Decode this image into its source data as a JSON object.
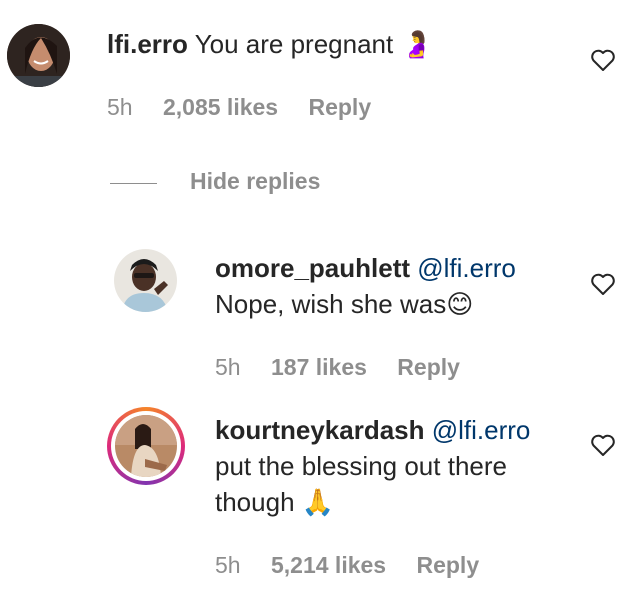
{
  "comments": [
    {
      "username": "lfi.erro",
      "mention": "",
      "text": "You are pregnant",
      "emoji": "🤰",
      "time": "5h",
      "likes": "2,085 likes",
      "reply": "Reply"
    },
    {
      "username": "omore_pauhlett",
      "mention": "@lfi.erro",
      "text": "Nope, wish she was",
      "emoji": "😊",
      "time": "5h",
      "likes": "187 likes",
      "reply": "Reply"
    },
    {
      "username": "kourtneykardash",
      "mention": "@lfi.erro",
      "text_line1": "put the blessing out there",
      "text_line2": "though",
      "emoji": "🙏",
      "time": "5h",
      "likes": "5,214 likes",
      "reply": "Reply",
      "has_story_ring": true
    }
  ],
  "hide_replies": "Hide replies",
  "icons": {
    "like": "heart-outline-icon"
  },
  "colors": {
    "primary_text": "#262626",
    "secondary_text": "#8e8e8e",
    "mention": "#00376b"
  }
}
